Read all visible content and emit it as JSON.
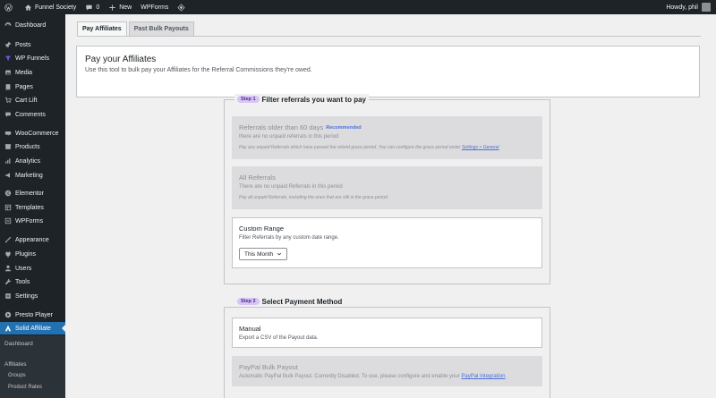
{
  "adminbar": {
    "site_name": "Funnel Society",
    "comments_count": "0",
    "new_label": "New",
    "wpforms_label": "WPForms",
    "howdy": "Howdy, phil"
  },
  "sidebar": {
    "items": [
      {
        "label": "Dashboard",
        "icon": "dashboard-icon"
      },
      {
        "label": "Posts",
        "icon": "pin-icon"
      },
      {
        "label": "WP Funnels",
        "icon": "funnel-icon"
      },
      {
        "label": "Media",
        "icon": "media-icon"
      },
      {
        "label": "Pages",
        "icon": "pages-icon"
      },
      {
        "label": "Cart Lift",
        "icon": "cart-icon"
      },
      {
        "label": "Comments",
        "icon": "comment-icon"
      },
      {
        "label": "WooCommerce",
        "icon": "woo-icon"
      },
      {
        "label": "Products",
        "icon": "products-icon"
      },
      {
        "label": "Analytics",
        "icon": "analytics-icon"
      },
      {
        "label": "Marketing",
        "icon": "megaphone-icon"
      },
      {
        "label": "Elementor",
        "icon": "elementor-icon"
      },
      {
        "label": "Templates",
        "icon": "templates-icon"
      },
      {
        "label": "WPForms",
        "icon": "forms-icon"
      },
      {
        "label": "Appearance",
        "icon": "brush-icon"
      },
      {
        "label": "Plugins",
        "icon": "plugin-icon"
      },
      {
        "label": "Users",
        "icon": "users-icon"
      },
      {
        "label": "Tools",
        "icon": "wrench-icon"
      },
      {
        "label": "Settings",
        "icon": "settings-icon"
      },
      {
        "label": "Presto Player",
        "icon": "play-icon"
      },
      {
        "label": "Solid Affiliate",
        "icon": "affiliate-icon"
      }
    ],
    "submenu": {
      "dashboard": "Dashboard",
      "affiliates": "Affiliates",
      "groups": "Groups",
      "product_rates": "Product Rates"
    }
  },
  "tabs": [
    {
      "label": "Pay Affiliates",
      "active": true
    },
    {
      "label": "Past Bulk Payouts",
      "active": false
    }
  ],
  "intro": {
    "title": "Pay your Affiliates",
    "description": "Use this tool to bulk pay your Affiliates for the Referral Commissions they're owed."
  },
  "step1": {
    "badge": "Step 1",
    "title": "Filter referrals you want to pay",
    "options": [
      {
        "title": "Referrals older than 60 days",
        "badge": "Recommended",
        "subtitle": "there are no unpaid referrals in this period",
        "note": "Pay any unpaid Referrals which have passed the refund grace period. You can configure the grace period under",
        "note_link": "Settings > General"
      },
      {
        "title": "All Referrals",
        "subtitle": "There are no unpaid Referrals in this period",
        "note": "Pay all unpaid Referrals, including the ones that are still in the grace period."
      },
      {
        "title": "Custom Range",
        "subtitle": "Filter Referrals by any custom date range.",
        "select_value": "This Month"
      }
    ]
  },
  "step2": {
    "badge": "Step 2",
    "title": "Select Payment Method",
    "options": [
      {
        "title": "Manual",
        "subtitle": "Export a CSV of the Payout data."
      },
      {
        "title": "PayPal Bulk Payout",
        "subtitle": "Automatic PayPal Bulk Payout. Currently Disabled. To use, please configure and enable your",
        "link": "PayPal Integration",
        "link_suffix": "."
      }
    ]
  },
  "colors": {
    "admin_dark": "#1d2327",
    "accent_blue": "#2271b1",
    "step_badge": "#d7c5f5",
    "link": "#4f6fd8"
  }
}
